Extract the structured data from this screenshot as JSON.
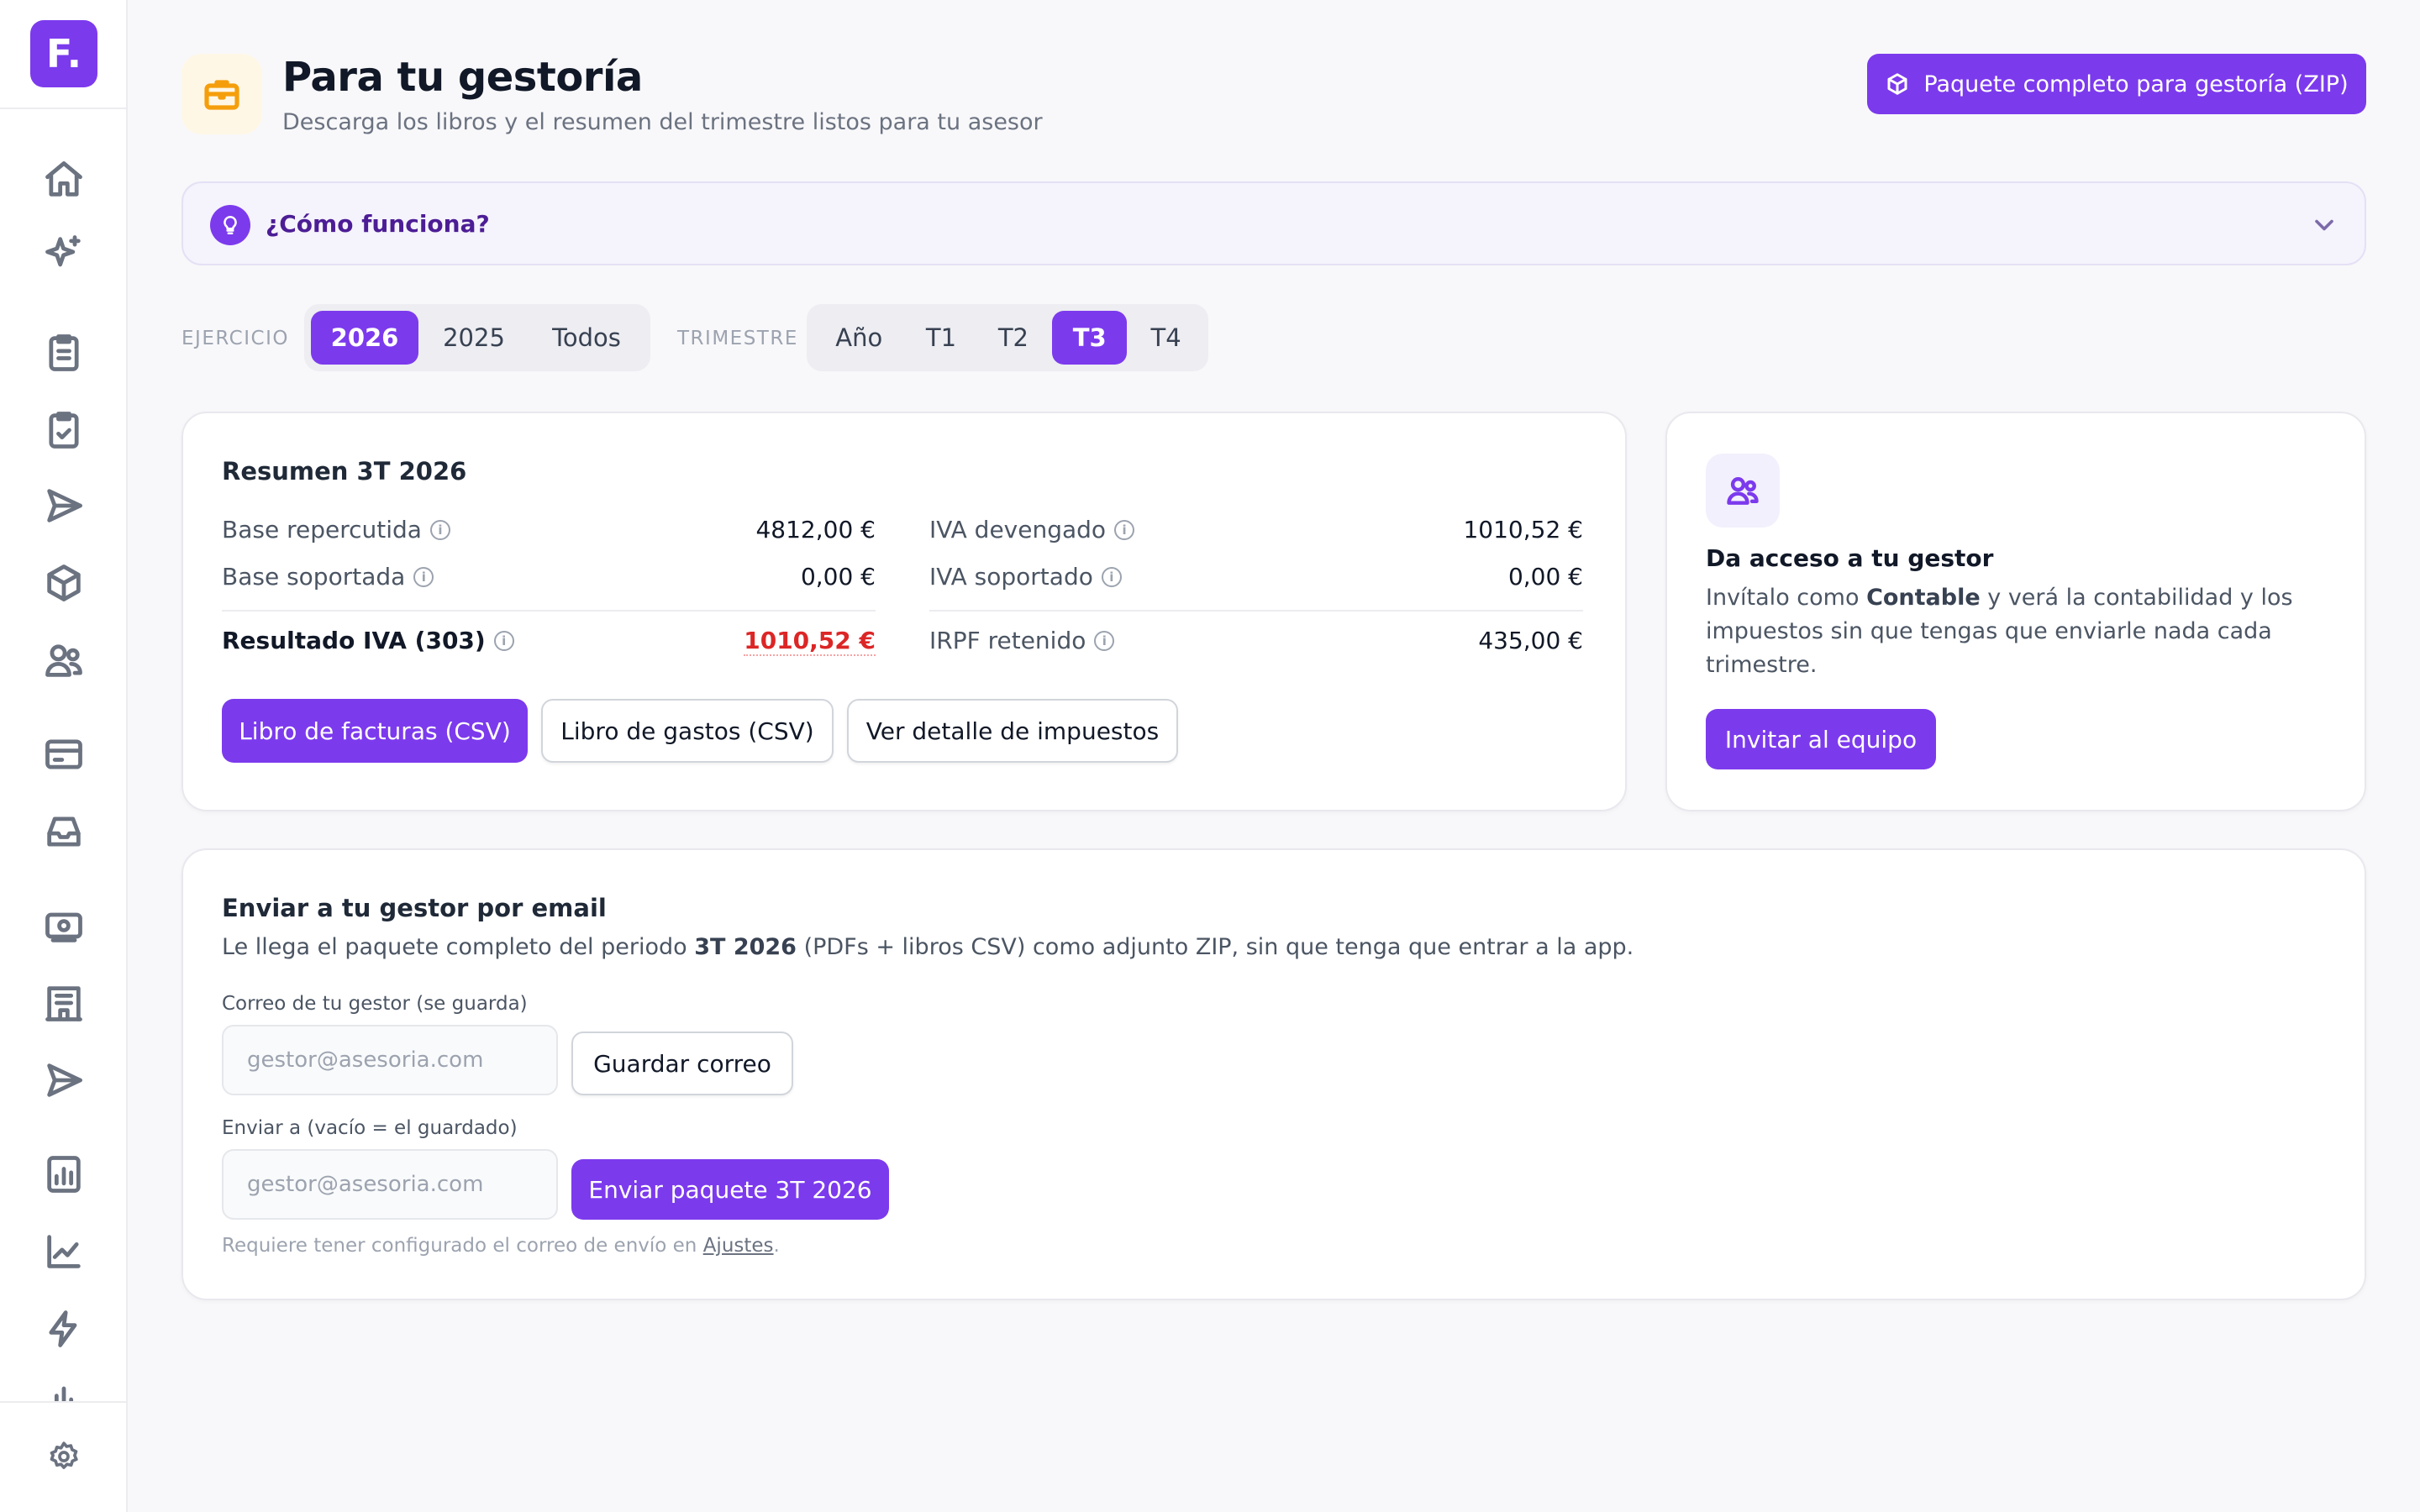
{
  "sidebar": {
    "logo": "F.",
    "icons": [
      "home-icon",
      "sparkles-icon",
      "invoices-icon",
      "checklist-icon",
      "send-icon",
      "package-icon",
      "users-icon",
      "card-icon",
      "inbox-icon",
      "cash-icon",
      "building-icon",
      "send-alt-icon",
      "report-icon",
      "chart-line-icon",
      "bolt-icon",
      "bar-chart-icon",
      "gear-icon"
    ]
  },
  "header": {
    "title": "Para tu gestoría",
    "subtitle": "Descarga los libros y el resumen del trimestre listos para tu asesor",
    "zip_button": "Paquete completo para gestoría (ZIP)"
  },
  "howto": {
    "label": "¿Cómo funciona?"
  },
  "filters": {
    "ejercicio_label": "EJERCICIO",
    "ejercicio_options": [
      "2026",
      "2025",
      "Todos"
    ],
    "ejercicio_selected": "2026",
    "trimestre_label": "TRIMESTRE",
    "trimestre_options": [
      "Año",
      "T1",
      "T2",
      "T3",
      "T4"
    ],
    "trimestre_selected": "T3"
  },
  "summary": {
    "title": "Resumen 3T 2026",
    "base_repercutida_label": "Base repercutida",
    "base_repercutida_value": "4812,00 €",
    "base_soportada_label": "Base soportada",
    "base_soportada_value": "0,00 €",
    "resultado_label": "Resultado IVA (303)",
    "resultado_value": "1010,52 €",
    "iva_devengado_label": "IVA devengado",
    "iva_devengado_value": "1010,52 €",
    "iva_soportado_label": "IVA soportado",
    "iva_soportado_value": "0,00 €",
    "irpf_label": "IRPF retenido",
    "irpf_value": "435,00 €",
    "btn_facturas": "Libro de facturas (CSV)",
    "btn_gastos": "Libro de gastos (CSV)",
    "btn_detalle": "Ver detalle de impuestos"
  },
  "access": {
    "title": "Da acceso a tu gestor",
    "text_before": "Invítalo como ",
    "text_bold": "Contable",
    "text_after": " y verá la contabilidad y los impuestos sin que tengas que enviarle nada cada trimestre.",
    "button": "Invitar al equipo"
  },
  "email": {
    "title": "Enviar a tu gestor por email",
    "desc_before": "Le llega el paquete completo del periodo ",
    "desc_bold": "3T 2026",
    "desc_after": " (PDFs + libros CSV) como adjunto ZIP, sin que tenga que entrar a la app.",
    "saved_label": "Correo de tu gestor (se guarda)",
    "saved_placeholder": "gestor@asesoria.com",
    "save_button": "Guardar correo",
    "send_label": "Enviar a (vacío = el guardado)",
    "send_placeholder": "gestor@asesoria.com",
    "send_button": "Enviar paquete 3T 2026",
    "note_before": "Requiere tener configurado el correo de envío en ",
    "note_link": "Ajustes",
    "note_after": "."
  },
  "colors": {
    "accent": "#7c3aed",
    "negative": "#dc2626",
    "warning_icon": "#f59e0b"
  }
}
